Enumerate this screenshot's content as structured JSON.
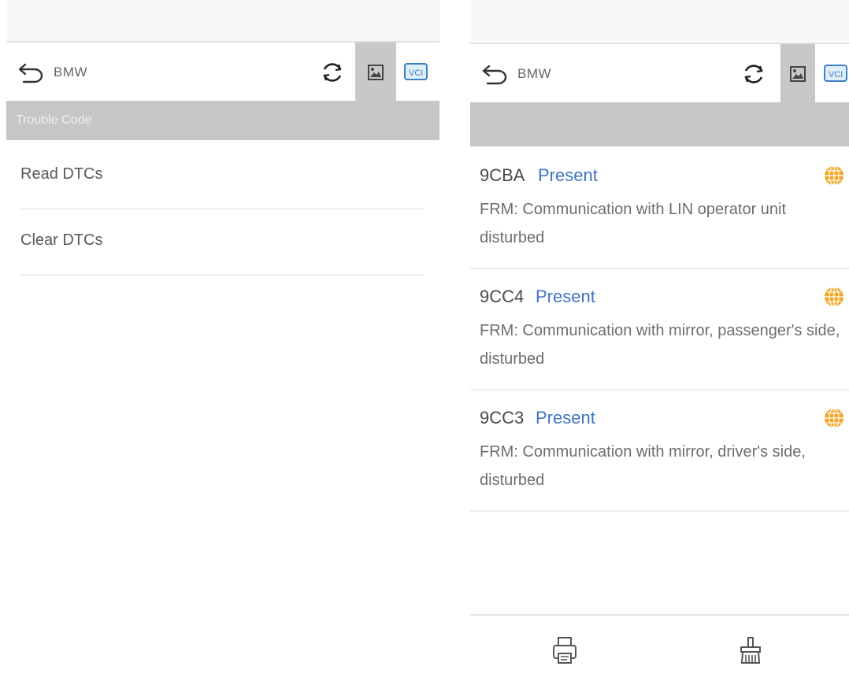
{
  "left": {
    "toolbar": {
      "title": "BMW"
    },
    "section_header": "Trouble Code",
    "menu": [
      {
        "label": "Read DTCs"
      },
      {
        "label": "Clear DTCs"
      }
    ]
  },
  "right": {
    "toolbar": {
      "title": "BMW"
    },
    "section_header": "",
    "dtcs": [
      {
        "code": "9CBA",
        "status": "Present",
        "description": "FRM: Communication with LIN operator unit disturbed"
      },
      {
        "code": "9CC4",
        "status": "Present",
        "description": "FRM: Communication with mirror, passenger's side, disturbed"
      },
      {
        "code": "9CC3",
        "status": "Present",
        "description": "FRM: Communication with mirror, driver's side, disturbed"
      }
    ]
  },
  "icons": {
    "back": "back-arrow-icon",
    "refresh": "refresh-icon",
    "screenshot": "screenshot-icon",
    "vci": "vci-icon",
    "globe": "globe-icon",
    "print": "print-icon",
    "clear": "clear-broom-icon"
  },
  "colors": {
    "status_present": "#3f74c2",
    "header_bg": "#c6c6c6",
    "globe": "#f5a623"
  }
}
